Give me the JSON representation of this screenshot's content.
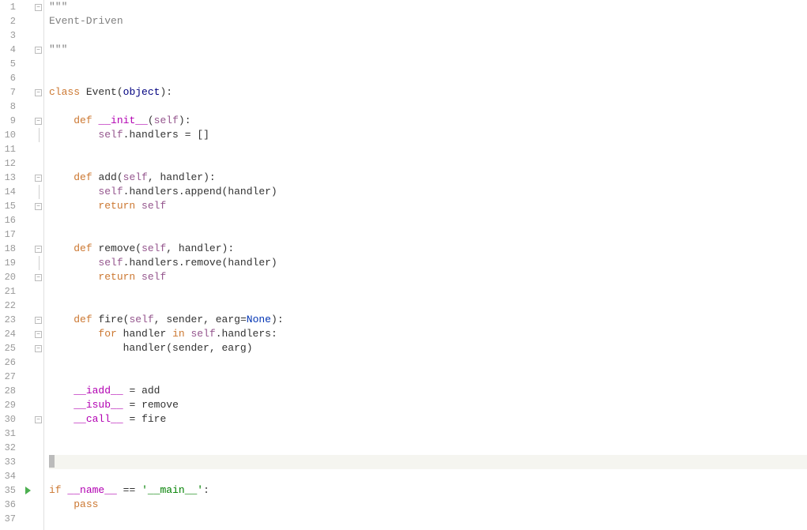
{
  "editor": {
    "current_line": 33,
    "line_count": 37,
    "run_line": 35
  },
  "fold_markers": {
    "1": "-",
    "4": "-",
    "7": "-",
    "9": "-",
    "10": "|",
    "13": "-",
    "14": "|",
    "15": "e",
    "18": "-",
    "19": "|",
    "20": "e",
    "23": "-",
    "24": "-",
    "25": "e",
    "30": "e"
  },
  "chart_data": {
    "type": "table",
    "title": "Python source code (Event-Driven pattern)",
    "rows": [
      {
        "line": 1,
        "text": "\"\"\""
      },
      {
        "line": 2,
        "text": "Event-Driven"
      },
      {
        "line": 3,
        "text": ""
      },
      {
        "line": 4,
        "text": "\"\"\""
      },
      {
        "line": 5,
        "text": ""
      },
      {
        "line": 6,
        "text": ""
      },
      {
        "line": 7,
        "text": "class Event(object):"
      },
      {
        "line": 8,
        "text": ""
      },
      {
        "line": 9,
        "text": "    def __init__(self):"
      },
      {
        "line": 10,
        "text": "        self.handlers = []"
      },
      {
        "line": 11,
        "text": ""
      },
      {
        "line": 12,
        "text": ""
      },
      {
        "line": 13,
        "text": "    def add(self, handler):"
      },
      {
        "line": 14,
        "text": "        self.handlers.append(handler)"
      },
      {
        "line": 15,
        "text": "        return self"
      },
      {
        "line": 16,
        "text": ""
      },
      {
        "line": 17,
        "text": ""
      },
      {
        "line": 18,
        "text": "    def remove(self, handler):"
      },
      {
        "line": 19,
        "text": "        self.handlers.remove(handler)"
      },
      {
        "line": 20,
        "text": "        return self"
      },
      {
        "line": 21,
        "text": ""
      },
      {
        "line": 22,
        "text": ""
      },
      {
        "line": 23,
        "text": "    def fire(self, sender, earg=None):"
      },
      {
        "line": 24,
        "text": "        for handler in self.handlers:"
      },
      {
        "line": 25,
        "text": "            handler(sender, earg)"
      },
      {
        "line": 26,
        "text": ""
      },
      {
        "line": 27,
        "text": ""
      },
      {
        "line": 28,
        "text": "    __iadd__ = add"
      },
      {
        "line": 29,
        "text": "    __isub__ = remove"
      },
      {
        "line": 30,
        "text": "    __call__ = fire"
      },
      {
        "line": 31,
        "text": ""
      },
      {
        "line": 32,
        "text": ""
      },
      {
        "line": 33,
        "text": ""
      },
      {
        "line": 34,
        "text": ""
      },
      {
        "line": 35,
        "text": "if __name__ == '__main__':"
      },
      {
        "line": 36,
        "text": "    pass"
      },
      {
        "line": 37,
        "text": ""
      }
    ]
  },
  "syntax_colors": {
    "keyword": "#cc7832",
    "def_kw": "#0033b3",
    "builtin": "#000080",
    "self": "#94558d",
    "dunder": "#b200b2",
    "string": "#008000",
    "none": "#0033b3",
    "docstring": "#808080"
  }
}
